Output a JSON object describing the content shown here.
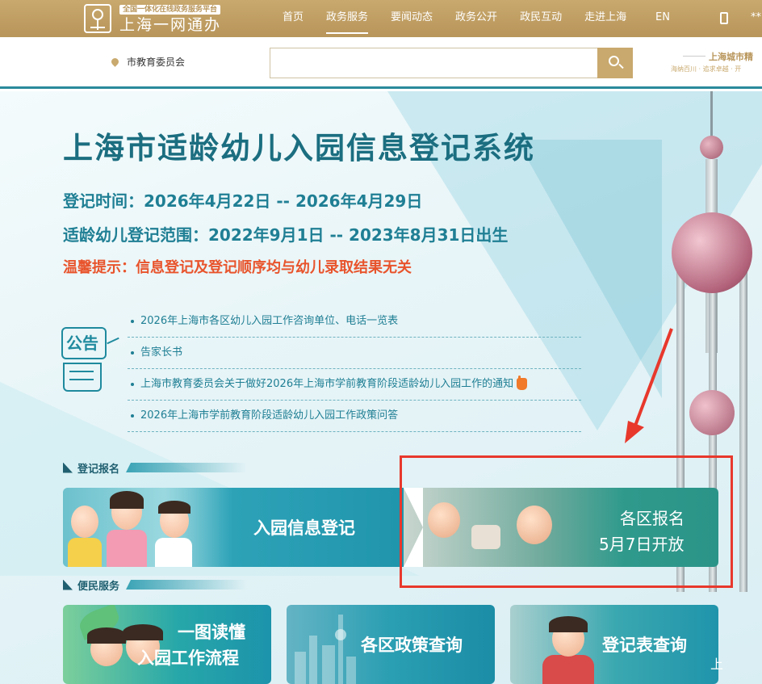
{
  "topnav": {
    "logo_tag": "全国一体化在线政务服务平台",
    "logo_name": "上海一网通办",
    "items": [
      {
        "label": "首页",
        "active": false
      },
      {
        "label": "政务服务",
        "active": true
      },
      {
        "label": "要闻动态",
        "active": false
      },
      {
        "label": "政务公开",
        "active": false
      },
      {
        "label": "政民互动",
        "active": false
      },
      {
        "label": "走进上海",
        "active": false
      }
    ],
    "en_label": "EN",
    "cut_text": "**"
  },
  "searchbar": {
    "location": "市教育委员会",
    "placeholder": "",
    "city_title": "上海城市精",
    "city_sub": "海纳百川 · 追求卓越 · 开"
  },
  "hero": {
    "title": "上海市适龄幼儿入园信息登记系统",
    "reg_time": "登记时间：2026年4月22日 -- 2026年4月29日",
    "reg_range": "适龄幼儿登记范围：2022年9月1日 -- 2023年8月31日出生",
    "tip": "温馨提示：信息登记及登记顺序均与幼儿录取结果无关"
  },
  "notice": {
    "icon_text": "公告",
    "items": [
      "2026年上海市各区幼儿入园工作咨询单位、电话一览表",
      "告家长书",
      "上海市教育委员会关于做好2026年上海市学前教育阶段适龄幼儿入园工作的通知",
      "2026年上海市学前教育阶段适龄幼儿入园工作政策问答"
    ]
  },
  "registration": {
    "section_title": "登记报名",
    "left_label": "入园信息登记",
    "right_line1": "各区报名",
    "right_line2": "5月7日开放"
  },
  "services": {
    "section_title": "便民服务",
    "card1_line1": "一图读懂",
    "card1_line2": "入园工作流程",
    "card2": "各区政策查询",
    "card3": "登记表查询",
    "edge_cut": "上"
  },
  "colors": {
    "gold": "#c9a96e",
    "teal": "#1f7f94",
    "tip_orange": "#e8542c",
    "highlight_red": "#e8382c"
  }
}
